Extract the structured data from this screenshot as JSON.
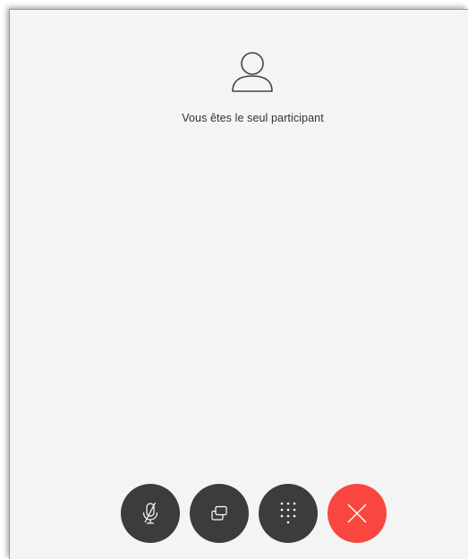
{
  "call": {
    "status_text": "Vous êtes le seul participant"
  },
  "icons": {
    "avatar": "person-outline-icon",
    "mute": "microphone-muted-icon",
    "share": "share-screen-icon",
    "keypad": "dialpad-icon",
    "end": "close-icon"
  },
  "colors": {
    "background": "#f4f4f4",
    "control_button": "#3c3c3c",
    "end_call_button": "#f9473f",
    "icon": "#ffffff"
  }
}
